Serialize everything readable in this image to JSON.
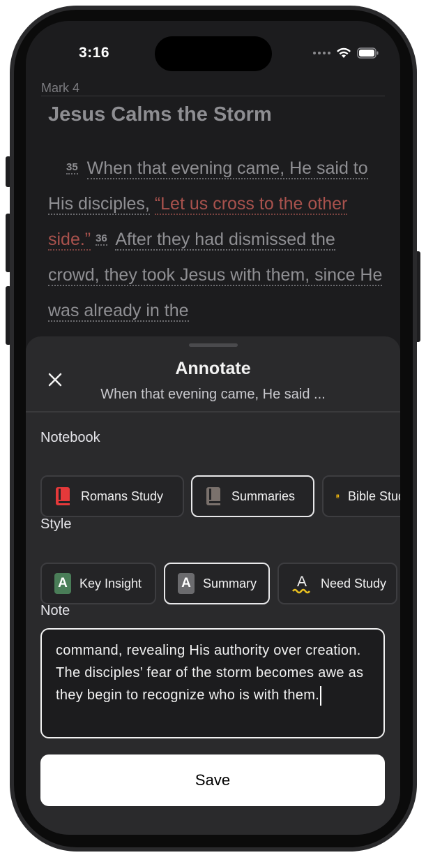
{
  "status": {
    "time": "3:16"
  },
  "reader": {
    "chapter": "Mark 4",
    "title": "Jesus Calms the Storm",
    "verses": [
      {
        "number": "35",
        "text_plain": "When that evening came, He said to His disciples,",
        "text_red": "“Let us cross to the other side.”"
      },
      {
        "number": "36",
        "text_plain": "After they had dismissed the crowd, they took Jesus with them, since He was already in the"
      }
    ]
  },
  "sheet": {
    "title": "Annotate",
    "subtitle": "When that evening came, He said ...",
    "notebook_label": "Notebook",
    "notebooks": [
      {
        "label": "Romans Study",
        "color": "#e5393a",
        "selected": false
      },
      {
        "label": "Summaries",
        "color": "#7a716c",
        "selected": true
      },
      {
        "label": "Bible Study",
        "color": "#e8b10f",
        "selected": false
      }
    ],
    "style_label": "Style",
    "styles": [
      {
        "label": "Key Insight",
        "color": "#4a7d58",
        "selected": false
      },
      {
        "label": "Summary",
        "color": "#6b6b6e",
        "selected": true
      },
      {
        "label": "Need Study",
        "color": "#e8c020",
        "selected": false
      }
    ],
    "style_badge_letter": "A",
    "note_label": "Note",
    "note_text": "command, revealing His authority over creation. The disciples’ fear of the storm becomes awe as they begin to recognize who is with them.",
    "save_label": "Save"
  }
}
